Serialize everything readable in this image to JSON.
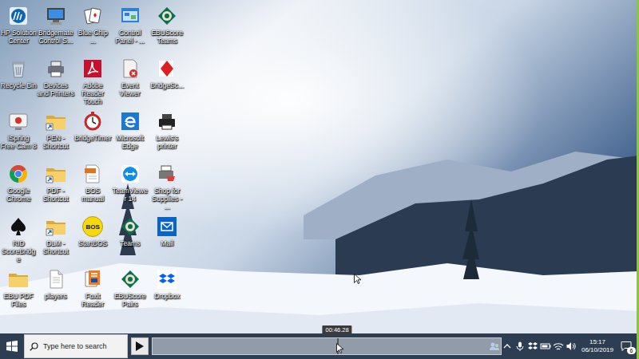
{
  "desktop": {
    "icons": [
      {
        "label": "HP Solution Center"
      },
      {
        "label": "Recycle Bin"
      },
      {
        "label": "iSpring Free Cam 8"
      },
      {
        "label": "Google Chrome"
      },
      {
        "label": "RID ScoreBridge"
      },
      {
        "label": "EBU PDF Files"
      },
      {
        "label": "Bridgemate Control S..."
      },
      {
        "label": "Devices and Printers"
      },
      {
        "label": "PEN - Shortcut"
      },
      {
        "label": "PDF - Shortcut"
      },
      {
        "label": "DLM - Shortcut"
      },
      {
        "label": "players"
      },
      {
        "label": "Blue Chip ..."
      },
      {
        "label": "Adobe Reader Touch"
      },
      {
        "label": "BridgeTimer"
      },
      {
        "label": "BOS manual"
      },
      {
        "label": "StartBOS",
        "logo_text": "BOS"
      },
      {
        "label": "Foxit Reader"
      },
      {
        "label": "Control Panel - ..."
      },
      {
        "label": "Event Viewer"
      },
      {
        "label": "Microsoft Edge"
      },
      {
        "label": "TeamViewer 14"
      },
      {
        "label": "Teams"
      },
      {
        "label": "EBUScore Pairs"
      },
      {
        "label": "EBUScore Teams"
      },
      {
        "label": "BridgeSc..."
      },
      {
        "label": "Lewis's printer"
      },
      {
        "label": "Shop for Supplies - ..."
      },
      {
        "label": "Mail"
      },
      {
        "label": "Dropbox"
      }
    ]
  },
  "taskbar": {
    "search": {
      "placeholder": "Type here to search"
    },
    "clock": {
      "time": "15:17",
      "date": "06/10/2019"
    },
    "notifications": {
      "count": "6"
    }
  },
  "video_player": {
    "timeline": {
      "level": 0.53,
      "tooltip": "00:46.28"
    }
  }
}
